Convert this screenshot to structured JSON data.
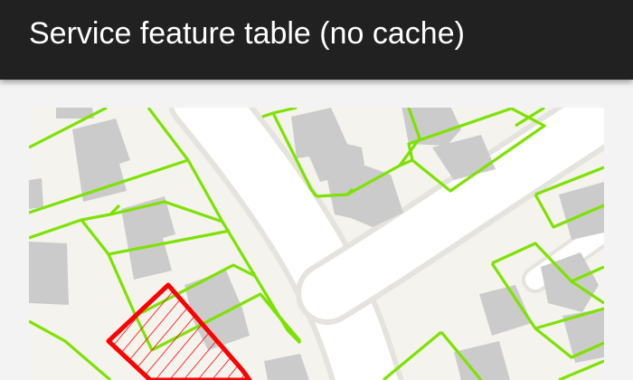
{
  "app_bar": {
    "title": "Service feature table (no cache)",
    "background_color": "#212121",
    "title_color": "#ffffff"
  },
  "map": {
    "basemap_land_color": "#f4f3ee",
    "road_color": "#ffffff",
    "building_color": "#cbcbcb",
    "parcel_outline_color": "#7ee200",
    "selected_feature_color": "#ff0000",
    "selected_feature_fill": "hatched"
  }
}
